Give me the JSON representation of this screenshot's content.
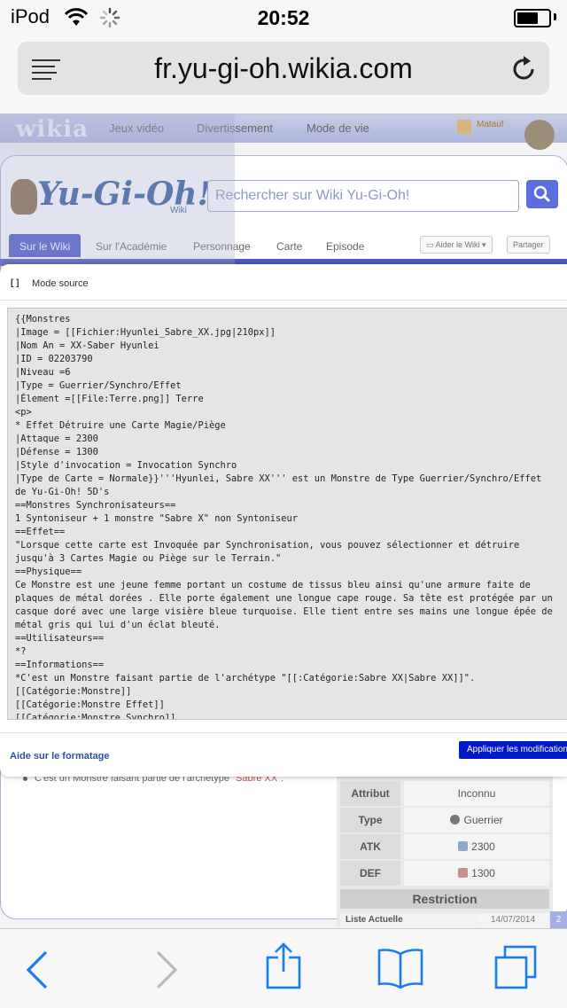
{
  "status_bar": {
    "carrier": "iPod",
    "time": "20:52",
    "battery_level": 0.6
  },
  "address_bar": {
    "url": "fr.yu-gi-oh.wikia.com",
    "icons": [
      "reader-menu-icon",
      "reload-icon"
    ]
  },
  "wiki": {
    "logo": "wikia",
    "nav": [
      "Jeux vidéo",
      "Divertissement",
      "Mode de vie"
    ],
    "user": "Matauf",
    "site_logo": "Yu-Gi-Oh!",
    "site_logo_sub": "Wiki",
    "search_placeholder": "Rechercher sur Wiki Yu-Gi-Oh!",
    "tabs": [
      "Sur le Wiki",
      "Sur l'Académie",
      "Personnage",
      "Carte",
      "Episode"
    ],
    "active_tab": "Sur le Wiki",
    "help_button": "Aider le Wiki",
    "share_button": "Partager",
    "bullet": {
      "prefix": "C'est un Monstre faisant partie de l'archétype \"",
      "link": "Sabre XX",
      "suffix": "\"."
    },
    "infobox": {
      "rows": [
        {
          "key": "Attribut",
          "value": "Inconnu",
          "icon": null
        },
        {
          "key": "Type",
          "value": "Guerrier",
          "icon": "type-icon"
        },
        {
          "key": "ATK",
          "value": "2300",
          "icon": "atk-icon"
        },
        {
          "key": "DEF",
          "value": "1300",
          "icon": "def-icon"
        }
      ],
      "restriction_header": "Restriction",
      "liste_label": "Liste Actuelle",
      "liste_value": "14/07/2014"
    },
    "scroll_label": "2"
  },
  "modal": {
    "brackets": "[ ]",
    "title": "Mode source",
    "source_lines": [
      "{{Monstres",
      "|Image = [[Fichier:Hyunlei_Sabre_XX.jpg|210px]]",
      "|Nom An = XX-Saber Hyunlei",
      "|ID = 02203790",
      "|Niveau =6",
      "|Type = Guerrier/Synchro/Effet",
      "|Élement =[[File:Terre.png]] Terre",
      "<p>",
      "* Effet Détruire une Carte Magie/Piège",
      "|Attaque = 2300",
      "|Défense = 1300",
      "|Style d'invocation = Invocation Synchro",
      "|Type de Carte = Normale}}'''Hyunlei, Sabre XX''' est un Monstre de Type Guerrier/Synchro/Effet",
      "de Yu-Gi-Oh! 5D's",
      "==Monstres Synchronisateurs==",
      "1 Syntoniseur + 1 monstre \"Sabre X\" non Syntoniseur",
      "==Effet==",
      "\"Lorsque cette carte est Invoquée par Synchronisation, vous pouvez sélectionner et détruire",
      "jusqu'à 3 Cartes Magie ou Piège sur le Terrain.\"",
      "==Physique==",
      "Ce Monstre est une jeune femme portant un costume de tissus bleu ainsi qu'une armure faite de",
      "plaques de métal dorées . Elle porte également une longue cape rouge. Sa tête est protégée par un",
      "casque doré avec une large visière bleue turquoise. Elle tient entre ses mains une longue épée de",
      "métal gris qui lui d'un éclat bleuté.",
      "==Utilisateurs==",
      "*?",
      "==Informations==",
      "*C'est un Monstre faisant partie de l'archétype \"[[:Catégorie:Sabre XX|Sabre XX]]\".",
      "[[Catégorie:Monstre]]",
      "[[Catégorie:Monstre Effet]]",
      "[[Catégorie:Monstre Synchro]]"
    ],
    "help_link": "Aide sur le formatage",
    "apply_button": "Appliquer les modifications"
  },
  "toolbar": {
    "items": [
      "back-icon",
      "forward-icon",
      "share-icon",
      "bookmarks-icon",
      "tabs-icon"
    ],
    "back_enabled": true,
    "forward_enabled": false
  },
  "colors": {
    "ios_blue": "#1a7cf5",
    "wiki_accent": "#4c59c8",
    "apply_button": "#0019c8",
    "link_red": "#c0504d"
  }
}
